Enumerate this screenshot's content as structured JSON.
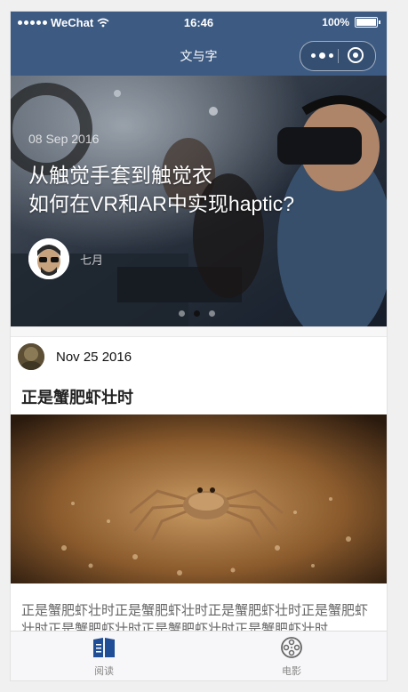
{
  "status_bar": {
    "carrier": "WeChat",
    "time": "16:46",
    "battery": "100%"
  },
  "nav": {
    "title": "文与字"
  },
  "swiper": {
    "date": "08 Sep 2016",
    "title_line1": "从触觉手套到触觉衣",
    "title_line2": "如何在VR和AR中实现haptic?",
    "author": "七月",
    "active_index": 1,
    "count": 3
  },
  "post": {
    "date": "Nov 25 2016",
    "title": "正是蟹肥虾壮时",
    "excerpt": "正是蟹肥虾壮时正是蟹肥虾壮时正是蟹肥虾壮时正是蟹肥虾壮时正是蟹肥虾壮时正是蟹肥虾壮时正是蟹肥虾壮时"
  },
  "tabbar": {
    "items": [
      {
        "label": "阅读",
        "icon": "reading-icon",
        "active": true
      },
      {
        "label": "电影",
        "icon": "film-reel-icon",
        "active": false
      }
    ]
  },
  "colors": {
    "nav_bg": "#3c5a82",
    "tab_active": "#1f4e96",
    "tab_inactive": "#888888"
  }
}
